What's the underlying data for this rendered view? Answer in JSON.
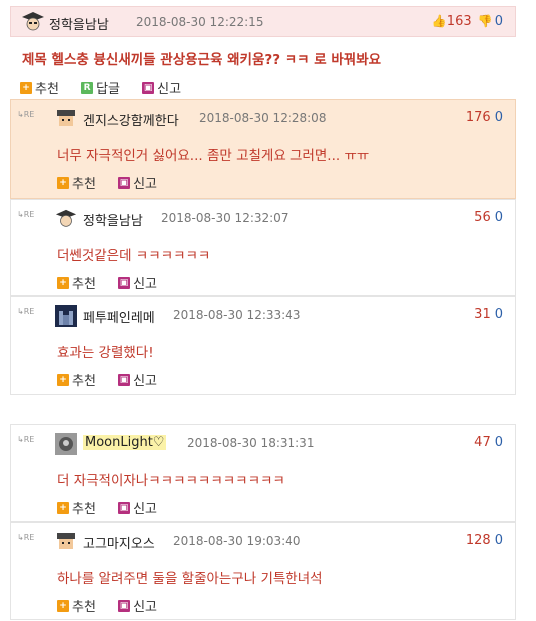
{
  "post": {
    "author": "정학을남남",
    "date": "2018-08-30 12:22:15",
    "upvotes": "163",
    "downvotes": "0",
    "title": "제목 헬스충 븅신새끼들 관상용근육 왜키움?? ㅋㅋ 로 바꿔봐요",
    "actions": {
      "recommend": "추천",
      "reply": "답글",
      "report": "신고"
    }
  },
  "comments": [
    {
      "re": "RE",
      "author": "겐지스강함께한다",
      "date": "2018-08-30 12:28:08",
      "up": "176",
      "down": "0",
      "text": "너무 자극적인거 싫어요... 좀만 고칠게요 그러면... ㅠㅠ",
      "recommend": "추천",
      "report": "신고"
    },
    {
      "re": "RE",
      "author": "정학을남남",
      "date": "2018-08-30 12:32:07",
      "up": "56",
      "down": "0",
      "text": "더쎈것같은데 ㅋㅋㅋㅋㅋㅋ",
      "recommend": "추천",
      "report": "신고"
    },
    {
      "re": "RE",
      "author": "페투페인레메",
      "date": "2018-08-30 12:33:43",
      "up": "31",
      "down": "0",
      "text": "효과는 강렬했다!",
      "recommend": "추천",
      "report": "신고"
    },
    {
      "re": "RE",
      "author": "MoonLight♡",
      "date": "2018-08-30 18:31:31",
      "up": "47",
      "down": "0",
      "text": "더 자극적이자나ㅋㅋㅋㅋㅋㅋㅋㅋㅋㅋㅋ",
      "recommend": "추천",
      "report": "신고"
    },
    {
      "re": "RE",
      "author": "고그마지오스",
      "date": "2018-08-30 19:03:40",
      "up": "128",
      "down": "0",
      "text": "하나를 알려주면 둘을 할줄아는구나 기특한녀석",
      "recommend": "추천",
      "report": "신고"
    }
  ],
  "icons": {
    "thumb_up": "thumb-up-icon",
    "thumb_down": "thumb-down-icon",
    "recommend": "plus-icon",
    "reply": "reply-icon",
    "report": "report-icon"
  },
  "colors": {
    "title_red": "#c0392b",
    "down_blue": "#2c5fa8",
    "highlight": "#fde9d6",
    "post_header": "#fbe8e8"
  }
}
